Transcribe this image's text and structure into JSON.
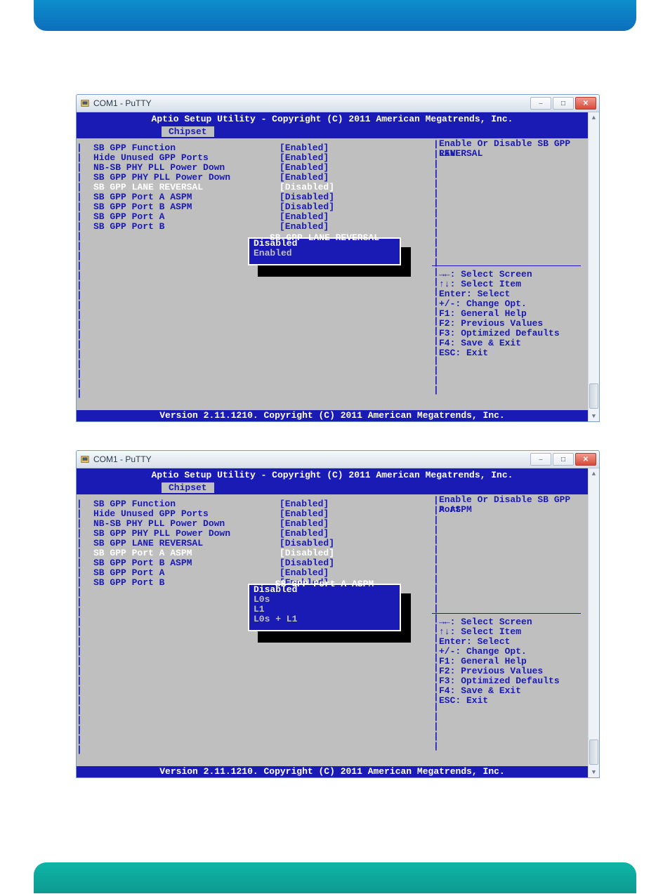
{
  "putty_title": "COM1 - PuTTY",
  "bios_header": "Aptio Setup Utility - Copyright (C) 2011 American Megatrends, Inc.",
  "bios_tab": "Chipset",
  "bios_footer": "Version 2.11.1210. Copyright (C) 2011 American Megatrends, Inc.",
  "help_keys": [
    "→←: Select Screen",
    "↑↓: Select Item",
    "Enter: Select",
    "+/-: Change Opt.",
    "F1: General Help",
    "F2: Previous Values",
    "F3: Optimized Defaults",
    "F4: Save & Exit",
    "ESC: Exit"
  ],
  "win_btn": {
    "min": "–",
    "max": "□",
    "close": "✕"
  },
  "shot1": {
    "settings": [
      {
        "label": "SB GPP Function",
        "value": "[Enabled]",
        "selected": false
      },
      {
        "label": "Hide Unused GPP Ports",
        "value": "[Enabled]",
        "selected": false
      },
      {
        "label": "NB-SB PHY PLL Power Down",
        "value": "[Enabled]",
        "selected": false
      },
      {
        "label": "SB GPP PHY PLL Power Down",
        "value": "[Enabled]",
        "selected": false
      },
      {
        "label": "SB GPP LANE REVERSAL",
        "value": "[Disabled]",
        "selected": true
      },
      {
        "label": "SB GPP Port A ASPM",
        "value": "[Disabled]",
        "selected": false
      },
      {
        "label": "SB GPP Port B ASPM",
        "value": "[Disabled]",
        "selected": false
      },
      {
        "label": "SB GPP Port A",
        "value": "[Enabled]",
        "selected": false
      },
      {
        "label": "SB GPP Port B",
        "value": "[Enabled]",
        "selected": false
      }
    ],
    "help_title": "Enable Or Disable SB GPP LANE REVERSAL",
    "popup_title": "SB GPP LANE REVERSAL",
    "popup_opts": [
      {
        "label": "Disabled",
        "selected": true
      },
      {
        "label": "Enabled",
        "selected": false
      }
    ]
  },
  "shot2": {
    "settings": [
      {
        "label": "SB GPP Function",
        "value": "[Enabled]",
        "selected": false
      },
      {
        "label": "Hide Unused GPP Ports",
        "value": "[Enabled]",
        "selected": false
      },
      {
        "label": "NB-SB PHY PLL Power Down",
        "value": "[Enabled]",
        "selected": false
      },
      {
        "label": "SB GPP PHY PLL Power Down",
        "value": "[Enabled]",
        "selected": false
      },
      {
        "label": "SB GPP LANE REVERSAL",
        "value": "[Disabled]",
        "selected": false
      },
      {
        "label": "SB GPP Port A ASPM",
        "value": "[Disabled]",
        "selected": true
      },
      {
        "label": "SB GPP Port B ASPM",
        "value": "[Disabled]",
        "selected": false
      },
      {
        "label": "SB GPP Port A",
        "value": "[Enabled]",
        "selected": false
      },
      {
        "label": "SB GPP Port B",
        "value": "[Enabled]",
        "selected": false
      }
    ],
    "help_title": "Enable Or Disable SB GPP Port A ASPM",
    "popup_title": "SB GPP Port A ASPM",
    "popup_opts": [
      {
        "label": "Disabled",
        "selected": true
      },
      {
        "label": "L0s",
        "selected": false
      },
      {
        "label": "L1",
        "selected": false
      },
      {
        "label": "L0s + L1",
        "selected": false
      }
    ]
  }
}
